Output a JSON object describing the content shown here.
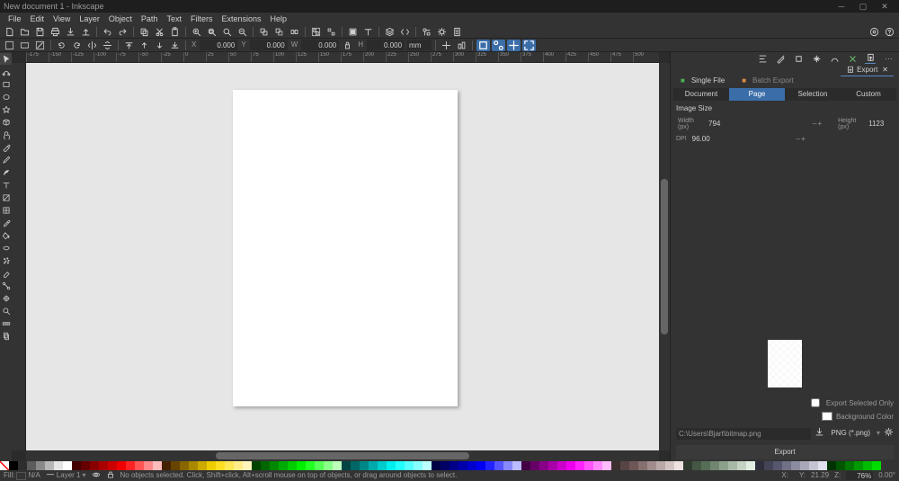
{
  "window": {
    "title": "New document 1 - Inkscape"
  },
  "menu": [
    "File",
    "Edit",
    "View",
    "Layer",
    "Object",
    "Path",
    "Text",
    "Filters",
    "Extensions",
    "Help"
  ],
  "toolbar2": {
    "x": "0.000",
    "y": "0.000",
    "w": "0.000",
    "h": "0.000",
    "unit": "mm"
  },
  "export": {
    "dock_tab_label": "Export",
    "mode_single": "Single File",
    "mode_batch": "Batch Export",
    "tabs": {
      "document": "Document",
      "page": "Page",
      "selection": "Selection",
      "custom": "Custom"
    },
    "section": "Image Size",
    "fields": {
      "w_label": "Width (px)",
      "w": "794",
      "h_label": "Height (px)",
      "h": "1123",
      "dpi_label": "DPI",
      "dpi": "96.00"
    },
    "checks": {
      "sel_only": "Export Selected Only",
      "bgcolor": "Background Color"
    },
    "path": "C:\\Users\\Bjart\\bitmap.png",
    "format": "PNG (*.png)",
    "button": "Export"
  },
  "status": {
    "fill_label": "Fill:",
    "fill": "N/A",
    "layer": "Layer 1",
    "hint": "No objects selected. Click, Shift+click, Alt+scroll mouse on top of objects, or drag around objects to select.",
    "x_label": "X:",
    "x": "",
    "y_label": "Y:",
    "y": "21.29",
    "z_label": "Z:",
    "zoom": "76%",
    "rot": "0.00°"
  },
  "ruler": [
    "-175",
    "-150",
    "-125",
    "-100",
    "-75",
    "-50",
    "-25",
    "0",
    "25",
    "50",
    "75",
    "100",
    "125",
    "150",
    "175",
    "200",
    "225",
    "250",
    "275",
    "300",
    "325",
    "350",
    "375",
    "400",
    "425",
    "450",
    "475",
    "500"
  ],
  "palette": [
    "none",
    "#000000",
    "#2e2e2e",
    "#5c5c5c",
    "#898989",
    "#b7b7b7",
    "#e5e5e5",
    "#ffffff",
    "#440000",
    "#660000",
    "#880000",
    "#aa0000",
    "#cc0000",
    "#ee0000",
    "#ff2222",
    "#ff5555",
    "#ff8888",
    "#ffbbbb",
    "#442200",
    "#664400",
    "#886600",
    "#aa8800",
    "#ccaa00",
    "#eecc00",
    "#ffdd22",
    "#ffe655",
    "#ffee88",
    "#fff5bb",
    "#004400",
    "#006600",
    "#008800",
    "#00aa00",
    "#00cc00",
    "#00ee00",
    "#22ff22",
    "#55ff55",
    "#88ff88",
    "#bbffbb",
    "#004444",
    "#006666",
    "#008888",
    "#00aaaa",
    "#00cccc",
    "#00eeee",
    "#22ffff",
    "#55ffff",
    "#88ffff",
    "#bbffff",
    "#000044",
    "#000066",
    "#000088",
    "#0000aa",
    "#0000cc",
    "#0000ee",
    "#2222ff",
    "#5555ff",
    "#8888ff",
    "#bbbbff",
    "#440044",
    "#660066",
    "#880088",
    "#aa00aa",
    "#cc00cc",
    "#ee00ee",
    "#ff22ff",
    "#ff55ff",
    "#ff88ff",
    "#ffbbff",
    "#3b2f2f",
    "#574444",
    "#6e5656",
    "#867070",
    "#a08c8c",
    "#b9a8a8",
    "#d3c4c4",
    "#ede1e1",
    "#2f3b2f",
    "#445744",
    "#566e56",
    "#708670",
    "#8ca08c",
    "#a8b9a8",
    "#c4d3c4",
    "#e1ede1",
    "#2f2f3b",
    "#444457",
    "#56566e",
    "#707086",
    "#8c8ca0",
    "#a8a8b9",
    "#c4c4d3",
    "#e1e1ed",
    "#003300",
    "#005500",
    "#007700",
    "#009900",
    "#00bb00",
    "#00dd00"
  ]
}
